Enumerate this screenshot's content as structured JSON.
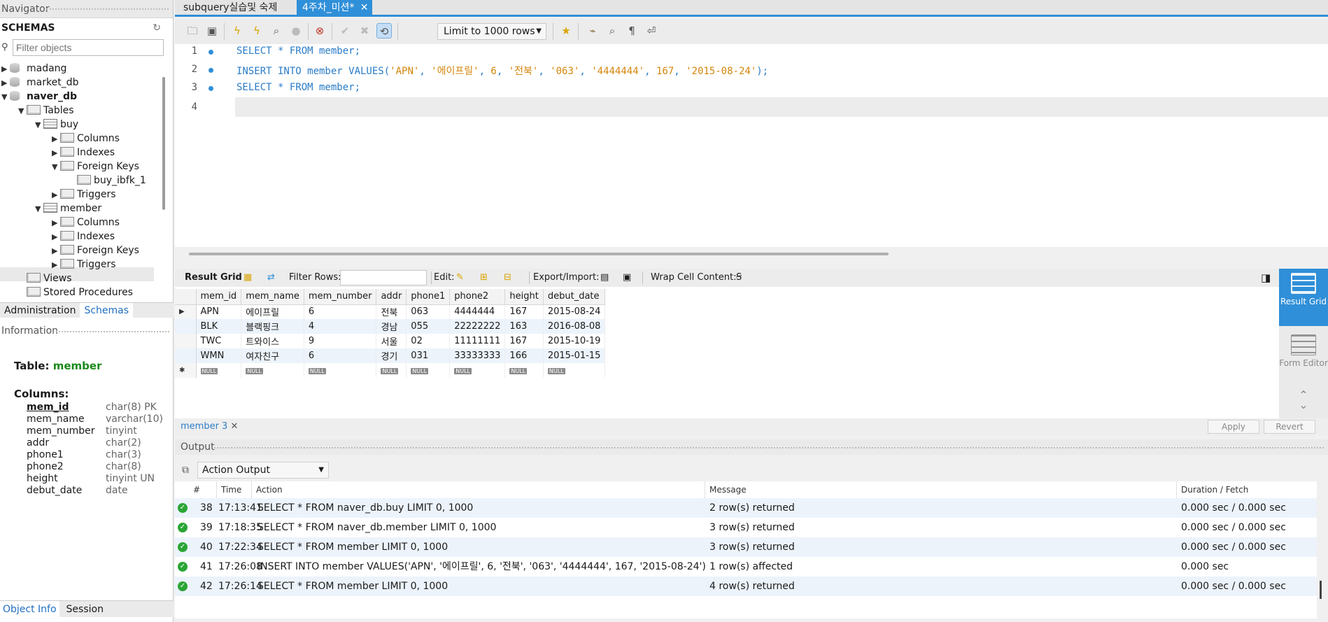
{
  "navigator": {
    "title": "Navigator",
    "schemas_label": "SCHEMAS",
    "filter_placeholder": "Filter objects",
    "tree": [
      {
        "label": "madang"
      },
      {
        "label": "market_db"
      },
      {
        "label": "naver_db"
      },
      {
        "label": "Tables"
      },
      {
        "label": "buy"
      },
      {
        "label": "Columns"
      },
      {
        "label": "Indexes"
      },
      {
        "label": "Foreign Keys"
      },
      {
        "label": "buy_ibfk_1"
      },
      {
        "label": "Triggers"
      },
      {
        "label": "member"
      },
      {
        "label": "Columns"
      },
      {
        "label": "Indexes"
      },
      {
        "label": "Foreign Keys"
      },
      {
        "label": "Triggers"
      },
      {
        "label": "Views"
      },
      {
        "label": "Stored Procedures"
      }
    ],
    "tabs": [
      "Administration",
      "Schemas"
    ]
  },
  "information": {
    "title": "Information",
    "table_prefix": "Table:",
    "table_name": "member",
    "columns_label": "Columns:",
    "columns": [
      {
        "name": "mem_id",
        "type": "char(8) PK"
      },
      {
        "name": "mem_name",
        "type": "varchar(10)"
      },
      {
        "name": "mem_number",
        "type": "tinyint"
      },
      {
        "name": "addr",
        "type": "char(2)"
      },
      {
        "name": "phone1",
        "type": "char(3)"
      },
      {
        "name": "phone2",
        "type": "char(8)"
      },
      {
        "name": "height",
        "type": "tinyint UN"
      },
      {
        "name": "debut_date",
        "type": "date"
      }
    ],
    "bottom_tabs": [
      "Object Info",
      "Session"
    ]
  },
  "editor_tabs": [
    "subquery실습및 숙제",
    "4주차_미션*"
  ],
  "toolbar": {
    "limit_label": "Limit to 1000 rows"
  },
  "editor": {
    "lines": [
      {
        "n": "1",
        "kw": "SELECT * FROM member;"
      },
      {
        "n": "2",
        "pre": "INSERT INTO member VALUES(",
        "a": "'APN'",
        "b": "'에이프릴'",
        "c": "6",
        "d": "'전북'",
        "e": "'063'",
        "f": "'4444444'",
        "g": "167",
        "h": "'2015-08-24'",
        "post": ");"
      },
      {
        "n": "3",
        "kw": "SELECT * FROM member;"
      },
      {
        "n": "4"
      }
    ]
  },
  "result_bar": {
    "result_grid": "Result Grid",
    "filter_rows": "Filter Rows:",
    "edit": "Edit:",
    "export_import": "Export/Import:",
    "wrap": "Wrap Cell Content:"
  },
  "result": {
    "headers": [
      "mem_id",
      "mem_name",
      "mem_number",
      "addr",
      "phone1",
      "phone2",
      "height",
      "debut_date"
    ],
    "rows": [
      [
        "APN",
        "에이프릴",
        "6",
        "전북",
        "063",
        "4444444",
        "167",
        "2015-08-24"
      ],
      [
        "BLK",
        "블랙핑크",
        "4",
        "경남",
        "055",
        "22222222",
        "163",
        "2016-08-08"
      ],
      [
        "TWC",
        "트와이스",
        "9",
        "서울",
        "02",
        "11111111",
        "167",
        "2015-10-19"
      ],
      [
        "WMN",
        "여자친구",
        "6",
        "경기",
        "031",
        "33333333",
        "166",
        "2015-01-15"
      ]
    ],
    "null_label": "NULL"
  },
  "side_buttons": [
    "Result Grid",
    "Form Editor"
  ],
  "result_footer": {
    "tab": "member 3",
    "apply": "Apply",
    "revert": "Revert"
  },
  "output": {
    "title": "Output",
    "mode": "Action Output",
    "headers": [
      "#",
      "Time",
      "Action",
      "Message",
      "Duration / Fetch"
    ],
    "rows": [
      {
        "n": "38",
        "time": "17:13:41",
        "action": "SELECT * FROM naver_db.buy LIMIT 0, 1000",
        "msg": "2 row(s) returned",
        "dur": "0.000 sec / 0.000 sec"
      },
      {
        "n": "39",
        "time": "17:18:35",
        "action": "SELECT * FROM naver_db.member LIMIT 0, 1000",
        "msg": "3 row(s) returned",
        "dur": "0.000 sec / 0.000 sec"
      },
      {
        "n": "40",
        "time": "17:22:34",
        "action": "SELECT * FROM member LIMIT 0, 1000",
        "msg": "3 row(s) returned",
        "dur": "0.000 sec / 0.000 sec"
      },
      {
        "n": "41",
        "time": "17:26:08",
        "action": "INSERT INTO member VALUES('APN', '에이프릴', 6, '전북', '063', '4444444', 167, '2015-08-24')",
        "msg": "1 row(s) affected",
        "dur": "0.000 sec"
      },
      {
        "n": "42",
        "time": "17:26:14",
        "action": "SELECT * FROM member LIMIT 0, 1000",
        "msg": "4 row(s) returned",
        "dur": "0.000 sec / 0.000 sec"
      }
    ]
  },
  "colors": {
    "accent": "#2f8fd8",
    "success": "#2aa535",
    "table_name": "#1b8a1b"
  }
}
